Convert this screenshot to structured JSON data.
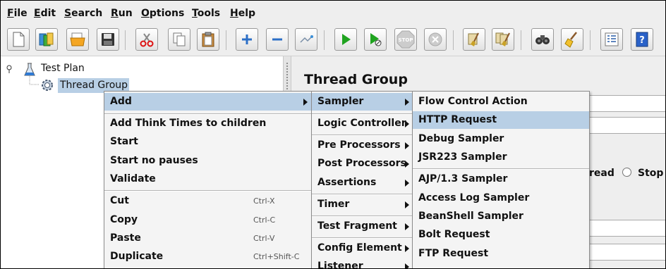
{
  "menubar": {
    "items": [
      "File",
      "Edit",
      "Search",
      "Run",
      "Options",
      "Tools",
      "Help"
    ],
    "mnemonics": [
      "F",
      "E",
      "S",
      "R",
      "O",
      "T",
      "H"
    ]
  },
  "toolbar": {
    "buttons": [
      "new-icon",
      "templates-icon",
      "open-icon",
      "save-icon",
      "cut-icon",
      "copy-icon",
      "paste-icon",
      "expand-icon",
      "collapse-icon",
      "toggle-icon",
      "start-icon",
      "start-no-pauses-icon",
      "stop-icon",
      "shutdown-icon",
      "clear-icon",
      "clear-all-icon",
      "search-icon",
      "reset-search-icon",
      "function-helper-icon",
      "help-icon"
    ],
    "stop_text": "STOP"
  },
  "tree": {
    "items": [
      "Test Plan",
      "Thread Group"
    ]
  },
  "right_panel": {
    "title": "Thread Group",
    "fragment_thread": "read",
    "option_stop": "Stop"
  },
  "context_menu": {
    "items": [
      {
        "label": "Add",
        "shortcut": "",
        "submenu": true,
        "highlighted": true
      },
      {
        "label": "Add Think Times to children",
        "shortcut": ""
      },
      {
        "label": "Start",
        "shortcut": ""
      },
      {
        "label": "Start no pauses",
        "shortcut": ""
      },
      {
        "label": "Validate",
        "shortcut": ""
      },
      {
        "label": "Cut",
        "shortcut": "Ctrl-X"
      },
      {
        "label": "Copy",
        "shortcut": "Ctrl-C"
      },
      {
        "label": "Paste",
        "shortcut": "Ctrl-V"
      },
      {
        "label": "Duplicate",
        "shortcut": "Ctrl+Shift-C"
      }
    ]
  },
  "add_submenu": {
    "items": [
      "Sampler",
      "Logic Controller",
      "Pre Processors",
      "Post Processors",
      "Assertions",
      "Timer",
      "Test Fragment",
      "Config Element",
      "Listener"
    ]
  },
  "sampler_submenu": {
    "items": [
      "Flow Control Action",
      "HTTP Request",
      "Debug Sampler",
      "JSR223 Sampler",
      "AJP/1.3 Sampler",
      "Access Log Sampler",
      "BeanShell Sampler",
      "Bolt Request",
      "FTP Request"
    ]
  },
  "colors": {
    "highlight": "#b8cfe5",
    "tree_selection": "#b8cfe5"
  }
}
